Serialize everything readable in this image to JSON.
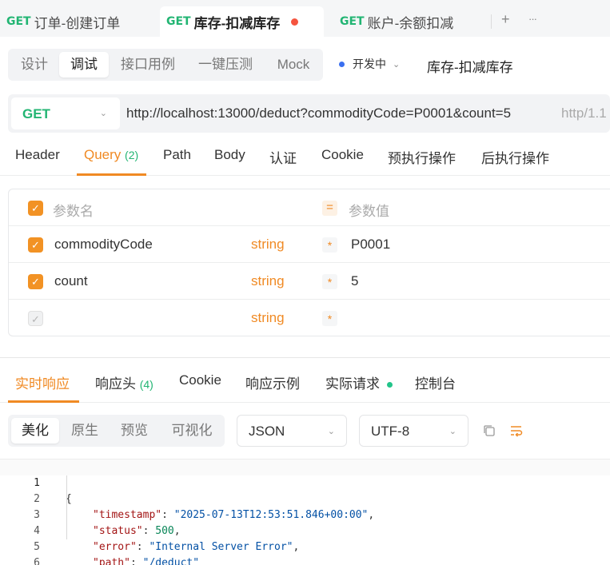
{
  "tabs": [
    {
      "method": "GET",
      "name": "订单-创建订单"
    },
    {
      "method": "GET",
      "name": "库存-扣减库存"
    },
    {
      "method": "GET",
      "name": "账户-余额扣减"
    }
  ],
  "tab_add_label": "+",
  "tab_more_label": "···",
  "modes": [
    "设计",
    "调试",
    "接口用例",
    "一键压测",
    "Mock"
  ],
  "env_status": "开发中",
  "request_name": "库存-扣减库存",
  "request": {
    "method": "GET",
    "url": "http://localhost:13000/deduct?commodityCode=P0001&count=5",
    "http_version": "http/1.1"
  },
  "param_tabs": {
    "header": "Header",
    "query": "Query",
    "query_count": "(2)",
    "path": "Path",
    "body": "Body",
    "auth": "认证",
    "cookie": "Cookie",
    "pre": "预执行操作",
    "post": "后执行操作"
  },
  "params_table": {
    "header_name": "参数名",
    "header_value": "参数值",
    "rows": [
      {
        "name": "commodityCode",
        "type": "string",
        "value": "P0001"
      },
      {
        "name": "count",
        "type": "string",
        "value": "5"
      },
      {
        "name": "",
        "type": "string",
        "value": ""
      }
    ]
  },
  "response_tabs": {
    "live": "实时响应",
    "headers": "响应头",
    "headers_count": "(4)",
    "cookie": "Cookie",
    "example": "响应示例",
    "actual": "实际请求",
    "console": "控制台"
  },
  "format_modes": [
    "美化",
    "原生",
    "预览",
    "可视化"
  ],
  "response_format": "JSON",
  "encoding": "UTF-8",
  "response_body": {
    "line_numbers": [
      "1",
      "2",
      "3",
      "4",
      "5",
      "6"
    ],
    "open_brace": "{",
    "close_brace": "}",
    "fields": [
      {
        "key": "\"timestamp\"",
        "value": "\"2025-07-13T12:53:51.846+00:00\"",
        "type": "string",
        "comma": ","
      },
      {
        "key": "\"status\"",
        "value": "500",
        "type": "number",
        "comma": ","
      },
      {
        "key": "\"error\"",
        "value": "\"Internal Server Error\"",
        "type": "string",
        "comma": ","
      },
      {
        "key": "\"path\"",
        "value": "\"/deduct\"",
        "type": "string",
        "comma": ""
      }
    ]
  },
  "colors": {
    "accent": "#f08a24",
    "method_get": "#22b573",
    "unsaved_dot": "#f5543f",
    "env_dot": "#3a6ff0"
  }
}
